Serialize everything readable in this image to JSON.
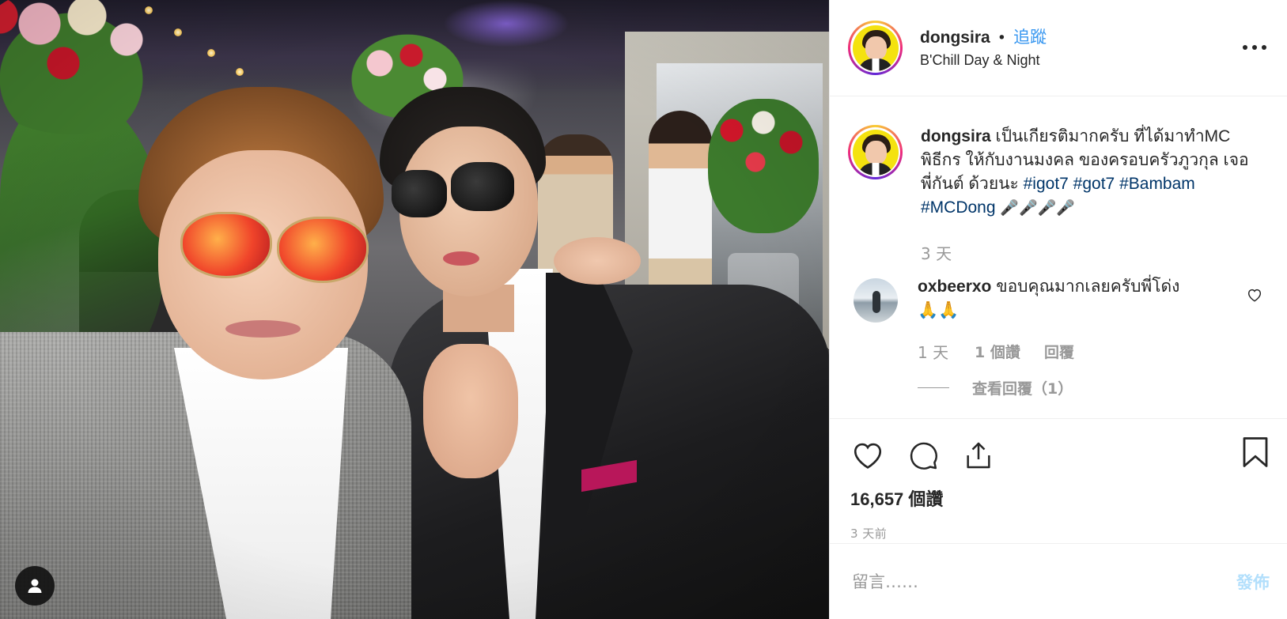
{
  "post": {
    "author": {
      "username": "dongsira",
      "separator": "•",
      "follow_label": "追蹤",
      "location": "B'Chill Day & Night"
    },
    "caption": {
      "username": "dongsira",
      "text": "เป็นเกียรติมากครับ ที่ได้มาทำMC พิธีกร ให้กับงานมงคล ของครอบครัวภูวกุล เจอ พี่กันต์ ด้วยนะ",
      "hashtags": [
        "#igot7",
        "#got7",
        "#Bambam",
        "#MCDong"
      ],
      "emoji": "🎤🎤🎤🎤",
      "time": "3 天"
    },
    "comments": [
      {
        "username": "oxbeerxo",
        "text": "ขอบคุณมากเลยครับพี่โด่ง",
        "emoji": "🙏🙏",
        "time": "1 天",
        "likes": "1 個讚",
        "reply_label": "回覆",
        "view_replies_label": "查看回覆（1）"
      }
    ],
    "likes_count": "16,657",
    "likes_suffix": "個讚",
    "posted_time": "3 天前",
    "comment_box": {
      "placeholder": "留言……",
      "post_label": "發佈"
    },
    "icons": {
      "more": "more-options-icon",
      "like": "heart-icon",
      "comment": "comment-icon",
      "share": "share-icon",
      "save": "bookmark-icon",
      "user_tag": "user-tag-icon"
    },
    "colors": {
      "link_blue": "#3897f0",
      "hashtag": "#003569",
      "muted": "#999999",
      "post_disabled": "#b2dffc"
    }
  }
}
